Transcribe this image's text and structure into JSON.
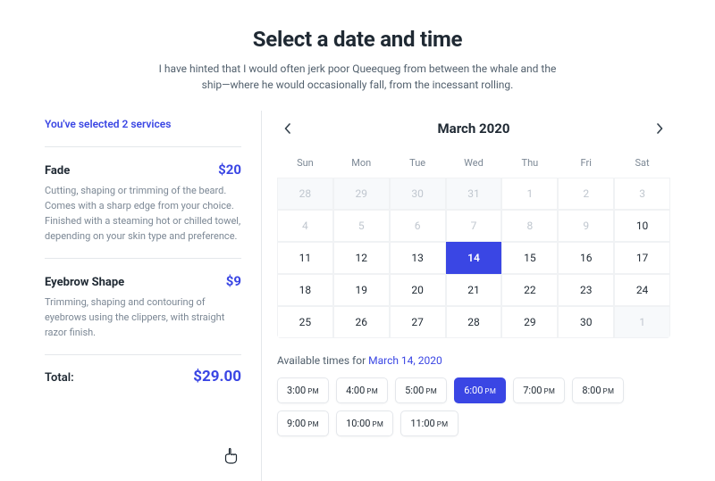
{
  "header": {
    "title": "Select a date and time",
    "subtitle": "I have hinted that I would often jerk poor Queequeg from between the whale and the ship—where he would occasionally fall, from the incessant rolling."
  },
  "sidebar": {
    "selected_line": "You've selected 2 services",
    "services": [
      {
        "name": "Fade",
        "price": "$20",
        "desc": "Cutting, shaping or trimming of the beard. Comes with a sharp edge from your choice. Finished with a steaming hot or chilled towel, depending on your skin type and preference."
      },
      {
        "name": "Eyebrow Shape",
        "price": "$9",
        "desc": "Trimming, shaping and contouring of eyebrows using the clippers, with straight razor finish."
      }
    ],
    "total_label": "Total:",
    "total_value": "$29.00"
  },
  "calendar": {
    "month_label": "March 2020",
    "dow": [
      "Sun",
      "Mon",
      "Tue",
      "Wed",
      "Thu",
      "Fri",
      "Sat"
    ],
    "cells": [
      {
        "n": "28",
        "state": "empty"
      },
      {
        "n": "29",
        "state": "empty"
      },
      {
        "n": "30",
        "state": "empty"
      },
      {
        "n": "31",
        "state": "empty"
      },
      {
        "n": "1",
        "state": "pale"
      },
      {
        "n": "2",
        "state": "pale"
      },
      {
        "n": "3",
        "state": "pale"
      },
      {
        "n": "4",
        "state": "pale"
      },
      {
        "n": "5",
        "state": "pale"
      },
      {
        "n": "6",
        "state": "pale"
      },
      {
        "n": "7",
        "state": "pale"
      },
      {
        "n": "8",
        "state": "pale"
      },
      {
        "n": "9",
        "state": "pale"
      },
      {
        "n": "10",
        "state": ""
      },
      {
        "n": "11",
        "state": ""
      },
      {
        "n": "12",
        "state": ""
      },
      {
        "n": "13",
        "state": ""
      },
      {
        "n": "14",
        "state": "sel"
      },
      {
        "n": "15",
        "state": ""
      },
      {
        "n": "16",
        "state": ""
      },
      {
        "n": "17",
        "state": ""
      },
      {
        "n": "18",
        "state": ""
      },
      {
        "n": "19",
        "state": ""
      },
      {
        "n": "20",
        "state": ""
      },
      {
        "n": "21",
        "state": ""
      },
      {
        "n": "22",
        "state": ""
      },
      {
        "n": "23",
        "state": ""
      },
      {
        "n": "24",
        "state": ""
      },
      {
        "n": "25",
        "state": ""
      },
      {
        "n": "26",
        "state": ""
      },
      {
        "n": "27",
        "state": ""
      },
      {
        "n": "28",
        "state": ""
      },
      {
        "n": "29",
        "state": ""
      },
      {
        "n": "30",
        "state": ""
      },
      {
        "n": "1",
        "state": "empty"
      }
    ]
  },
  "available": {
    "prefix": "Available times for ",
    "date": "March 14, 2020",
    "slots": [
      {
        "time": "3:00",
        "ap": "PM",
        "sel": false
      },
      {
        "time": "4:00",
        "ap": "PM",
        "sel": false
      },
      {
        "time": "5:00",
        "ap": "PM",
        "sel": false
      },
      {
        "time": "6:00",
        "ap": "PM",
        "sel": true
      },
      {
        "time": "7:00",
        "ap": "PM",
        "sel": false
      },
      {
        "time": "8:00",
        "ap": "PM",
        "sel": false
      },
      {
        "time": "9:00",
        "ap": "PM",
        "sel": false
      },
      {
        "time": "10:00",
        "ap": "PM",
        "sel": false
      },
      {
        "time": "11:00",
        "ap": "PM",
        "sel": false
      }
    ]
  }
}
